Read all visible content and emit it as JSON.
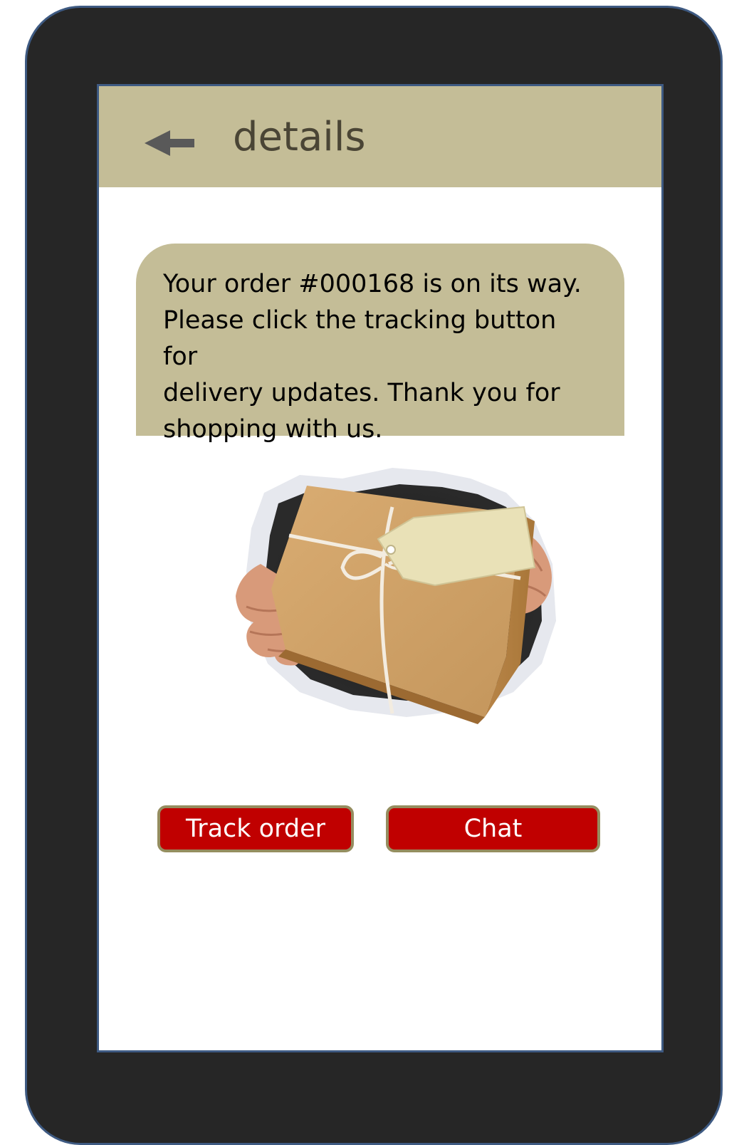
{
  "header": {
    "back_icon": "back-arrow-icon",
    "title": "details"
  },
  "message": {
    "line1": "Your order #000168 is on its way.",
    "line2": "Please click the tracking button for",
    "line3": "delivery updates.  Thank you for",
    "line4": "shopping with us."
  },
  "image": {
    "subject": "hands holding a wrapped package with tag, bursting through paper"
  },
  "actions": {
    "track_label": "Track order",
    "chat_label": "Chat"
  },
  "colors": {
    "header_bg": "#c4bd97",
    "button_bg": "#c00000",
    "button_border": "#958d5f",
    "device_body": "#262626",
    "device_border": "#3e5a82"
  }
}
